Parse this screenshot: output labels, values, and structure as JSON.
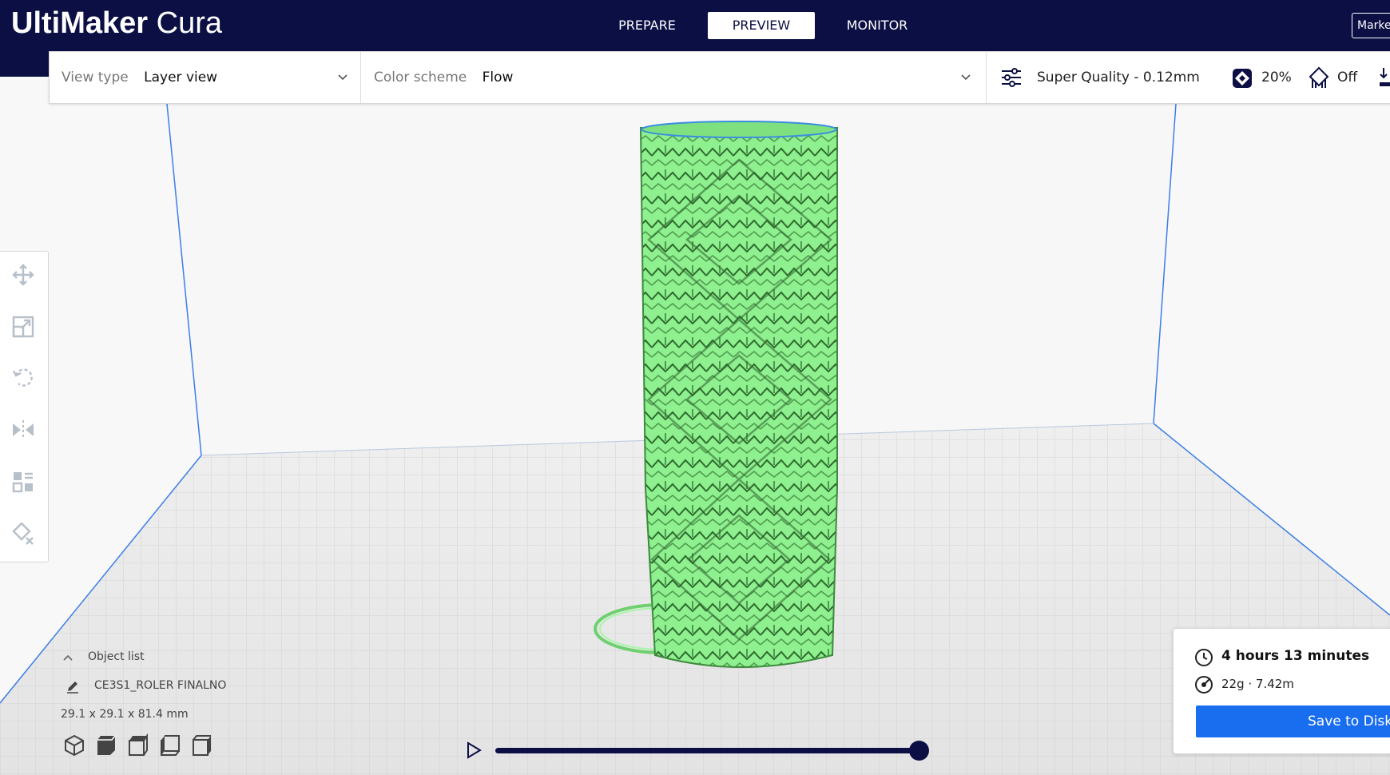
{
  "app": {
    "title_bold": "UltiMaker",
    "title_light": "Cura",
    "marketplace_label": "Market"
  },
  "stages": {
    "prepare": "PREPARE",
    "preview": "PREVIEW",
    "monitor": "MONITOR",
    "active": "PREVIEW"
  },
  "toolbar": {
    "view_type_label": "View type",
    "view_type_value": "Layer view",
    "color_scheme_label": "Color scheme",
    "color_scheme_value": "Flow",
    "profile": "Super Quality - 0.12mm",
    "infill": "20%",
    "support": "Off"
  },
  "icons": {
    "tools": [
      "move-icon",
      "scale-icon",
      "rotate-icon",
      "mirror-icon",
      "per-model-settings-icon",
      "support-blocker-icon"
    ],
    "views": [
      "view-3d-icon",
      "view-front-icon",
      "view-top-icon",
      "view-left-icon",
      "view-right-icon"
    ]
  },
  "object_list": {
    "header": "Object list",
    "object_name": "CE3S1_ROLER FINALNO",
    "dimensions": "29.1 x 29.1 x 81.4 mm"
  },
  "layer_slider": {
    "progress": 1.0
  },
  "summary": {
    "print_time": "4 hours 13 minutes",
    "material": "22g · 7.42m",
    "save_label": "Save to Disk"
  },
  "colors": {
    "header_bg": "#0b0f44",
    "accent_blue": "#196ef0",
    "model_green": "#8ef08e",
    "build_volume_line": "#3d7ee8"
  }
}
